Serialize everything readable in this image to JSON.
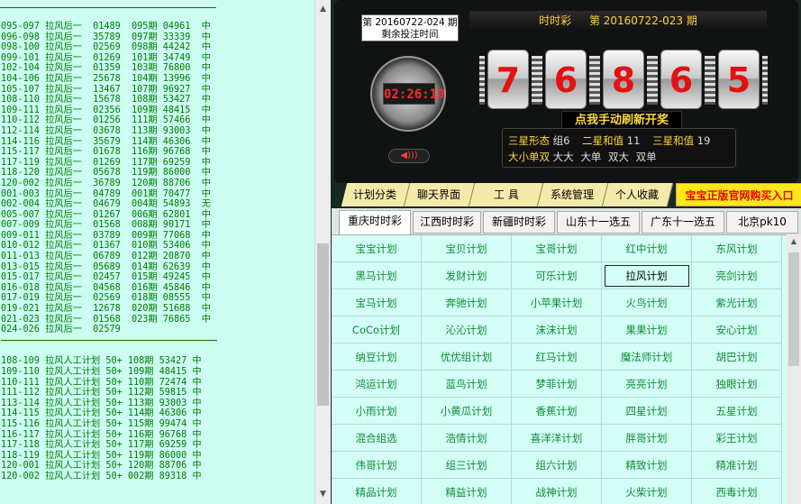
{
  "left_list": {
    "lines": [
      "095-097 拉风后一  01489  095期 04961  中",
      "096-098 拉风后一  35789  097期 33339  中",
      "098-100 拉风后一  02569  098期 44242  中",
      "099-101 拉风后一  01269  101期 34749  中",
      "102-104 拉风后一  01359  103期 76800  中",
      "104-106 拉风后一  25678  104期 13996  中",
      "105-107 拉风后一  13467  107期 96927  中",
      "108-110 拉风后一  15678  108期 53427  中",
      "109-111 拉风后一  02356  109期 48415  中",
      "110-112 拉风后一  01256  111期 57466  中",
      "112-114 拉风后一  03678  113期 93003  中",
      "114-116 拉风后一  35679  114期 46306  中",
      "115-117 拉风后一  01678  116期 96768  中",
      "117-119 拉风后一  01269  117期 69259  中",
      "118-120 拉风后一  05678  119期 86000  中",
      "120-002 拉风后一  36789  120期 88706  中",
      "001-003 拉风后一  04789  001期 70477  中",
      "002-004 拉风后一  04679  004期 54893  无",
      "005-007 拉风后一  01267  006期 62801  中",
      "007-009 拉风后一  01568  008期 90171  中",
      "009-011 拉风后一  03789  009期 77068  中",
      "010-012 拉风后一  01367  010期 53406  中",
      "011-013 拉风后一  06789  012期 20870  中",
      "013-015 拉风后一  05689  014期 62639  中",
      "015-017 拉风后一  02457  015期 49245  中",
      "016-018 拉风后一  04568  016期 45846  中",
      "017-019 拉风后一  02569  018期 08555  中",
      "019-021 拉风后一  12678  020期 51688  中",
      "021-023 拉风后一  01568  023期 76865  中",
      "024-026 拉风后一  02579"
    ],
    "lines2": [
      "108-109 拉风人工计划 50+ 108期 53427 中",
      "109-110 拉风人工计划 50+ 109期 48415 中",
      "110-111 拉风人工计划 50+ 110期 72474 中",
      "111-112 拉风人工计划 50+ 112期 59815 中",
      "113-114 拉风人工计划 50+ 113期 93003 中",
      "114-115 拉风人工计划 50+ 114期 46306 中",
      "115-116 拉风人工计划 50+ 115期 99474 中",
      "116-117 拉风人工计划 50+ 116期 96768 中",
      "117-118 拉风人工计划 50+ 117期 69259 中",
      "118-119 拉风人工计划 50+ 119期 86000 中",
      "120-001 拉风人工计划 50+ 120期 88706 中",
      "120-002 拉风人工计划 50+ 002期 89318 中"
    ]
  },
  "lottery": {
    "period_label": "第 20160722-024 期",
    "remaining_label": "剩余投注时间",
    "timer": "02:26:10",
    "name": "时时彩",
    "current_period": "第  20160722-023  期",
    "digits": [
      "7",
      "6",
      "8",
      "6",
      "5"
    ],
    "refresh_label": "点我手动刷新开奖",
    "stats": {
      "sanxing_label": "三星形态",
      "sanxing_value": "组6",
      "erxing_label": "二星和值",
      "erxing_value": "11",
      "sanhe_label": "三星和值",
      "sanhe_value": "19",
      "dxds_label": "大小单双",
      "dxds_values": [
        "大大",
        "大单",
        "双大",
        "双单"
      ]
    }
  },
  "menu": {
    "items": [
      "计划分类",
      "聊天界面",
      "工  具",
      "系统管理",
      "个人收藏"
    ],
    "buy_label": "宝宝正版官网购买入口"
  },
  "tabs": [
    "重庆时时彩",
    "江西时时彩",
    "新疆时时彩",
    "山东十一选五",
    "广东十一选五",
    "北京pk10"
  ],
  "plans": [
    [
      "宝宝计划",
      "宝贝计划",
      "宝哥计划",
      "红中计划",
      "东风计划"
    ],
    [
      "黑马计划",
      "发财计划",
      "可乐计划",
      "拉风计划",
      "亮剑计划"
    ],
    [
      "宝马计划",
      "奔驰计划",
      "小苹果计划",
      "火鸟计划",
      "紫光计划"
    ],
    [
      "CoCo计划",
      "沁沁计划",
      "沫沫计划",
      "果果计划",
      "安心计划"
    ],
    [
      "纳豆计划",
      "优优组计划",
      "红马计划",
      "魔法师计划",
      "胡巴计划"
    ],
    [
      "鸿运计划",
      "蓝鸟计划",
      "梦菲计划",
      "亮亮计划",
      "独眼计划"
    ],
    [
      "小雨计划",
      "小黄瓜计划",
      "香蕉计划",
      "四星计划",
      "五星计划"
    ],
    [
      "混合组选",
      "浩情计划",
      "喜洋洋计划",
      "胖哥计划",
      "彩王计划"
    ],
    [
      "伟哥计划",
      "组三计划",
      "组六计划",
      "精致计划",
      "精准计划"
    ],
    [
      "精品计划",
      "精益计划",
      "战神计划",
      "火柴计划",
      "西毒计划"
    ]
  ],
  "icons": {
    "sound": "speaker-icon",
    "scroll_up": "arrow-up-icon",
    "scroll_down": "arrow-down-icon"
  },
  "colors": {
    "accent": "#ffd23a",
    "digit": "#e31111",
    "plan_text": "#0f8a34",
    "left_text": "#007a00"
  }
}
